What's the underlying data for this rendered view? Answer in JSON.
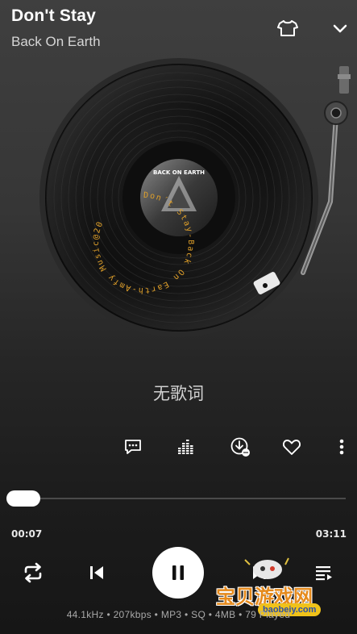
{
  "song": {
    "title": "Don't Stay",
    "artist": "Back On Earth"
  },
  "header_icons": {
    "skin": "tshirt-icon",
    "collapse": "chevron-down-icon"
  },
  "record": {
    "ring_text": "Don´t Stay-Back On Earth-Amfy Music@20",
    "cover_text": "BACK ON EARTH"
  },
  "lyrics": {
    "empty_text": "无歌词"
  },
  "actions": [
    {
      "name": "comment",
      "icon": "comment-icon"
    },
    {
      "name": "equalizer",
      "icon": "equalizer-icon"
    },
    {
      "name": "download",
      "icon": "download-icon"
    },
    {
      "name": "favorite",
      "icon": "heart-icon"
    },
    {
      "name": "more",
      "icon": "more-vertical-icon"
    }
  ],
  "progress": {
    "current": "00:07",
    "total": "03:11",
    "fraction": 0.037
  },
  "controls": {
    "repeat": "repeat-icon",
    "previous": "previous-icon",
    "pause": "pause-icon",
    "next": "next-icon",
    "playlist": "playlist-icon"
  },
  "quality_info": "44.1kHz • 207kbps • MP3 • SQ • 4MB • 79 Played",
  "watermark": {
    "title": "宝贝游戏网",
    "url": "baobeiy.com"
  }
}
